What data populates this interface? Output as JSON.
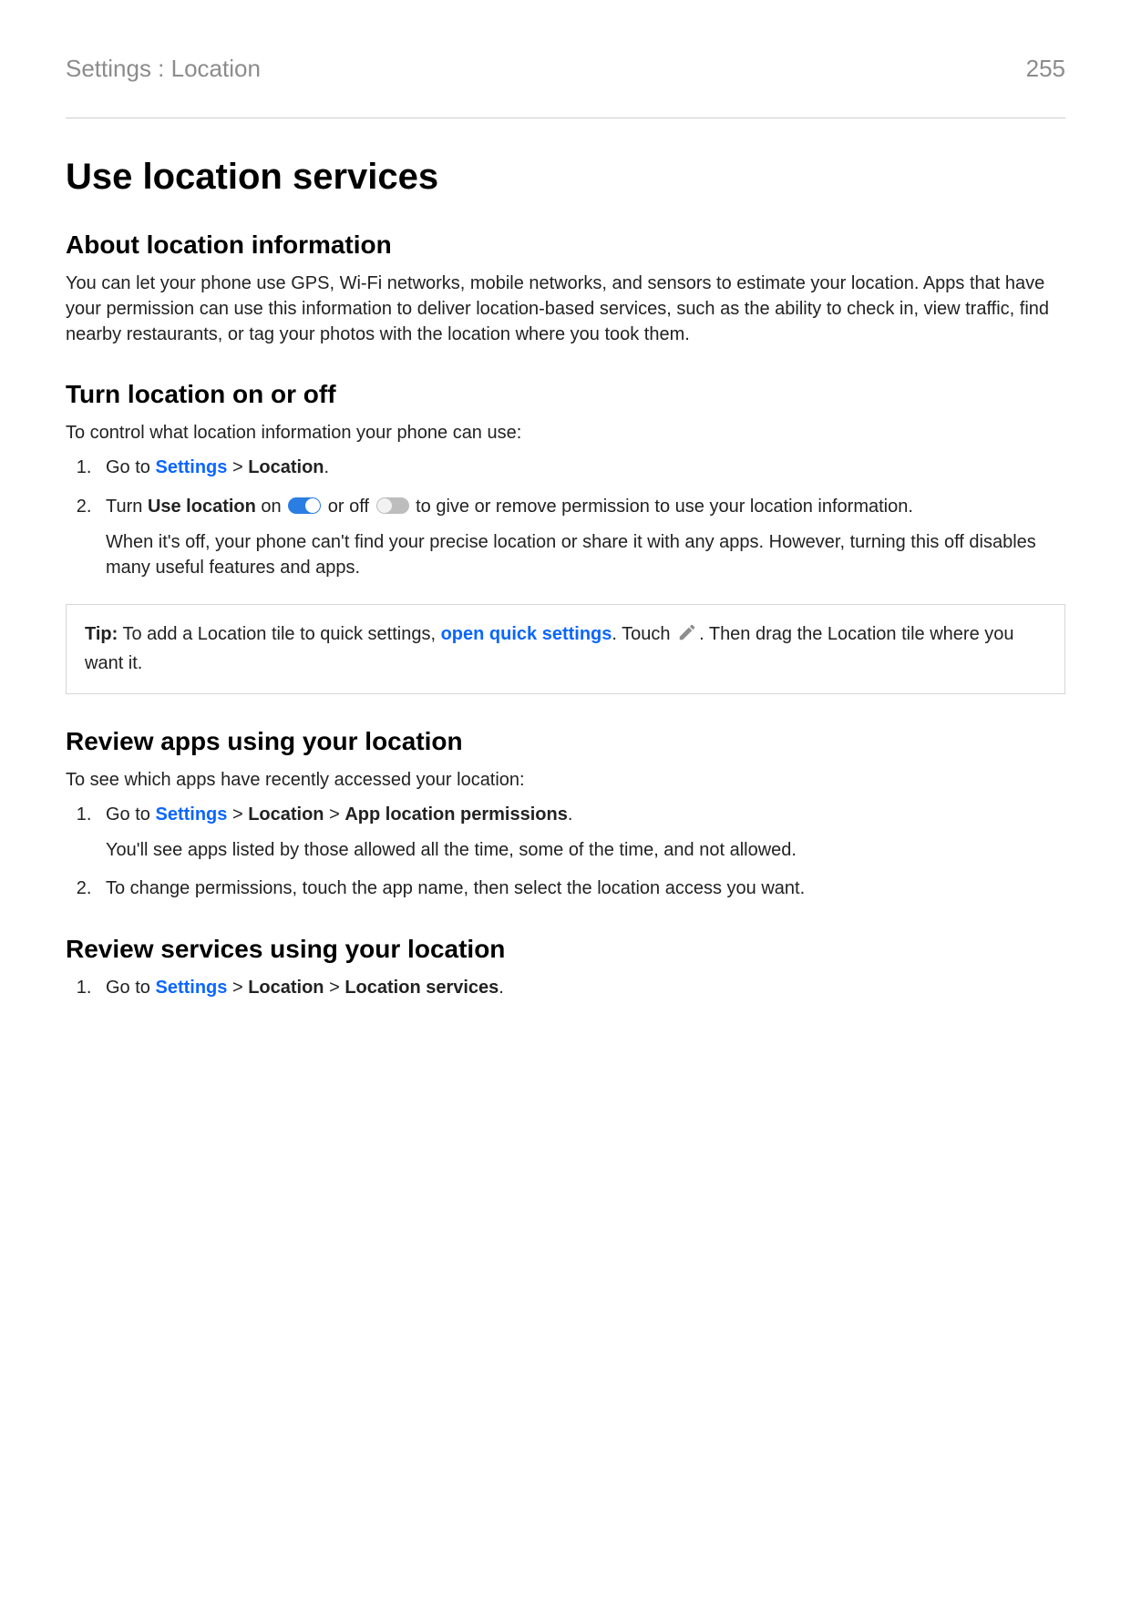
{
  "header": {
    "breadcrumb": "Settings : Location",
    "page_number": "255"
  },
  "title": "Use location services",
  "sections": {
    "about": {
      "heading": "About location information",
      "body": "You can let your phone use GPS, Wi-Fi networks, mobile networks, and sensors to estimate your location. Apps that have your permission can use this information to deliver location-based services, such as the ability to check in, view traffic, find nearby restaurants, or tag your photos with the location where you took them."
    },
    "turn": {
      "heading": "Turn location on or off",
      "intro": "To control what location information your phone can use:",
      "step1": {
        "prefix": "Go to ",
        "settings_link": "Settings",
        "sep": " > ",
        "location_bold": "Location",
        "suffix": "."
      },
      "step2": {
        "t1": "Turn ",
        "use_location_bold": "Use location",
        "t2": " on ",
        "t3": " or off ",
        "t4": " to give or remove permission to use your location information.",
        "note": "When it's off, your phone can't find your precise location or share it with any apps. However, turning this off disables many useful features and apps."
      },
      "tip": {
        "label": "Tip:",
        "t1": " To add a Location tile to quick settings, ",
        "link": "open quick settings",
        "t2": ". Touch ",
        "t3": ". Then drag the Location tile where you want it."
      }
    },
    "review_apps": {
      "heading": "Review apps using your location",
      "intro": "To see which apps have recently accessed your location:",
      "step1": {
        "prefix": "Go to ",
        "settings_link": "Settings",
        "sep": " > ",
        "location_bold": "Location",
        "sep2": " > ",
        "perms_bold": "App location permissions",
        "suffix": ".",
        "note": "You'll see apps listed by those allowed all the time, some of the time, and not allowed."
      },
      "step2": "To change permissions, touch the app name, then select the location access you want."
    },
    "review_services": {
      "heading": "Review services using your location",
      "step1": {
        "prefix": "Go to ",
        "settings_link": "Settings",
        "sep": " > ",
        "location_bold": "Location",
        "sep2": " > ",
        "svc_bold": "Location services",
        "suffix": "."
      }
    }
  }
}
